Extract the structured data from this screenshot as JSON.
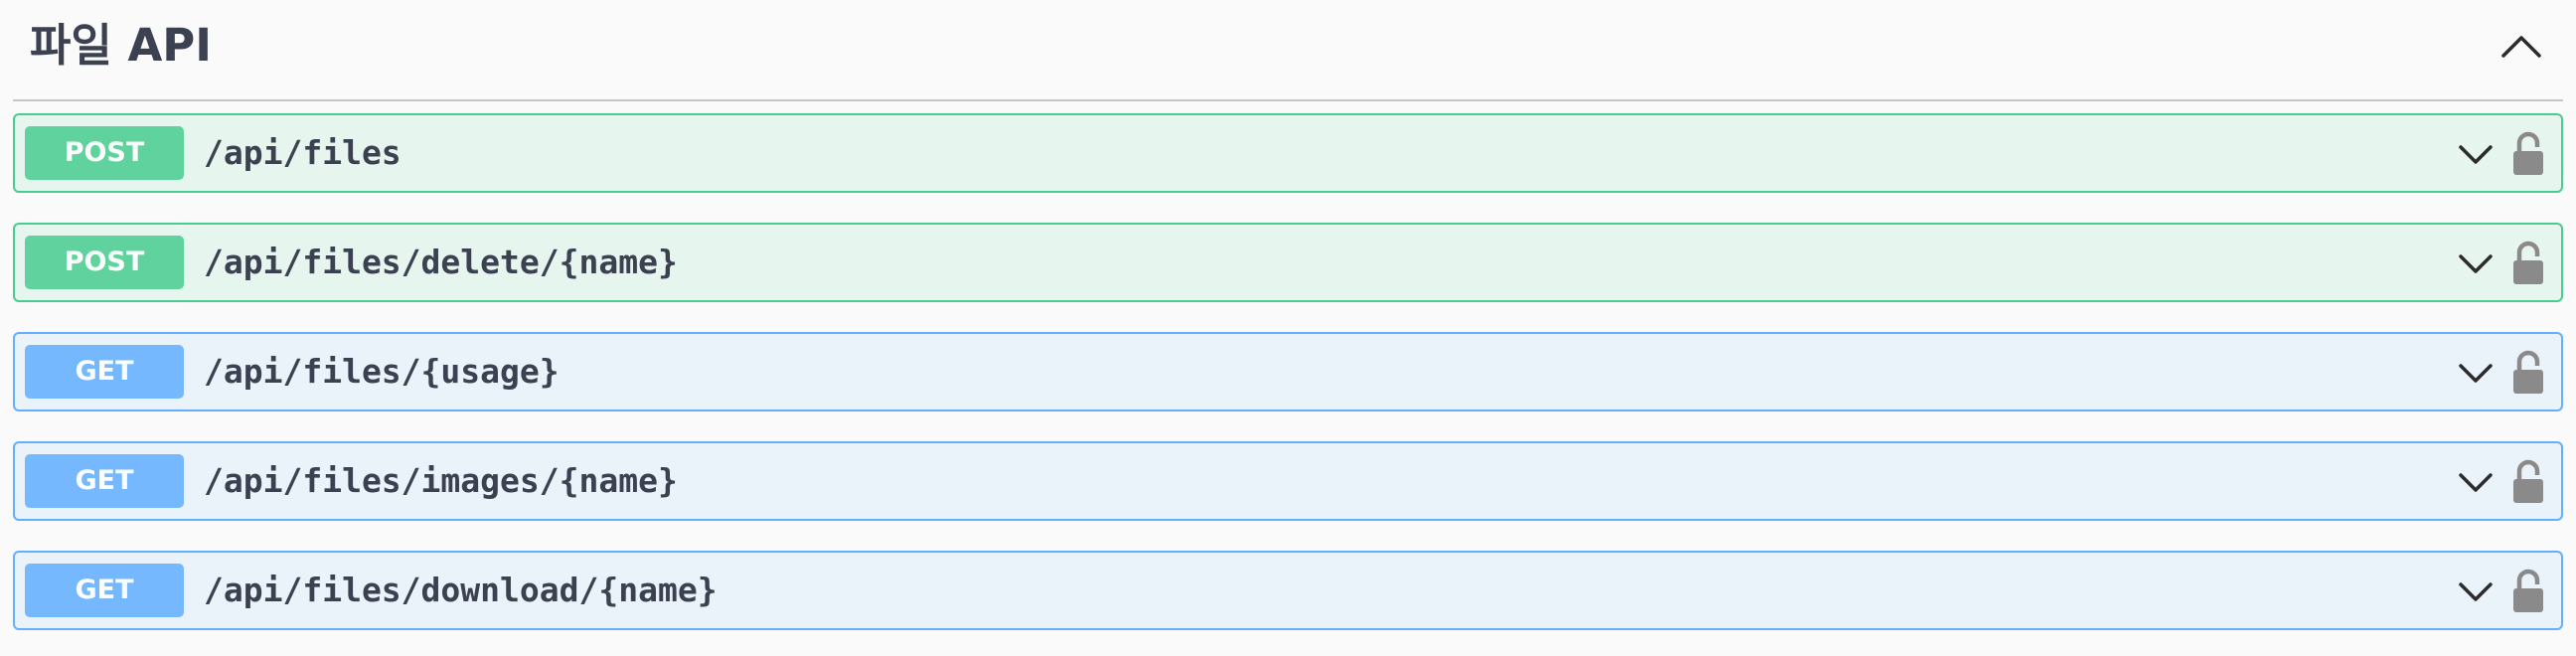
{
  "section": {
    "title": "파일 API"
  },
  "operations": [
    {
      "method": "POST",
      "path": "/api/files"
    },
    {
      "method": "POST",
      "path": "/api/files/delete/{name}"
    },
    {
      "method": "GET",
      "path": "/api/files/{usage}"
    },
    {
      "method": "GET",
      "path": "/api/files/images/{name}"
    },
    {
      "method": "GET",
      "path": "/api/files/download/{name}"
    }
  ],
  "colors": {
    "post": "#49cc90",
    "get": "#61affe",
    "text": "#3b4151",
    "lock": "#8a8a8a"
  },
  "icons": {
    "collapse": "chevron-up-icon",
    "expand": "chevron-down-icon",
    "auth": "lock-icon"
  }
}
